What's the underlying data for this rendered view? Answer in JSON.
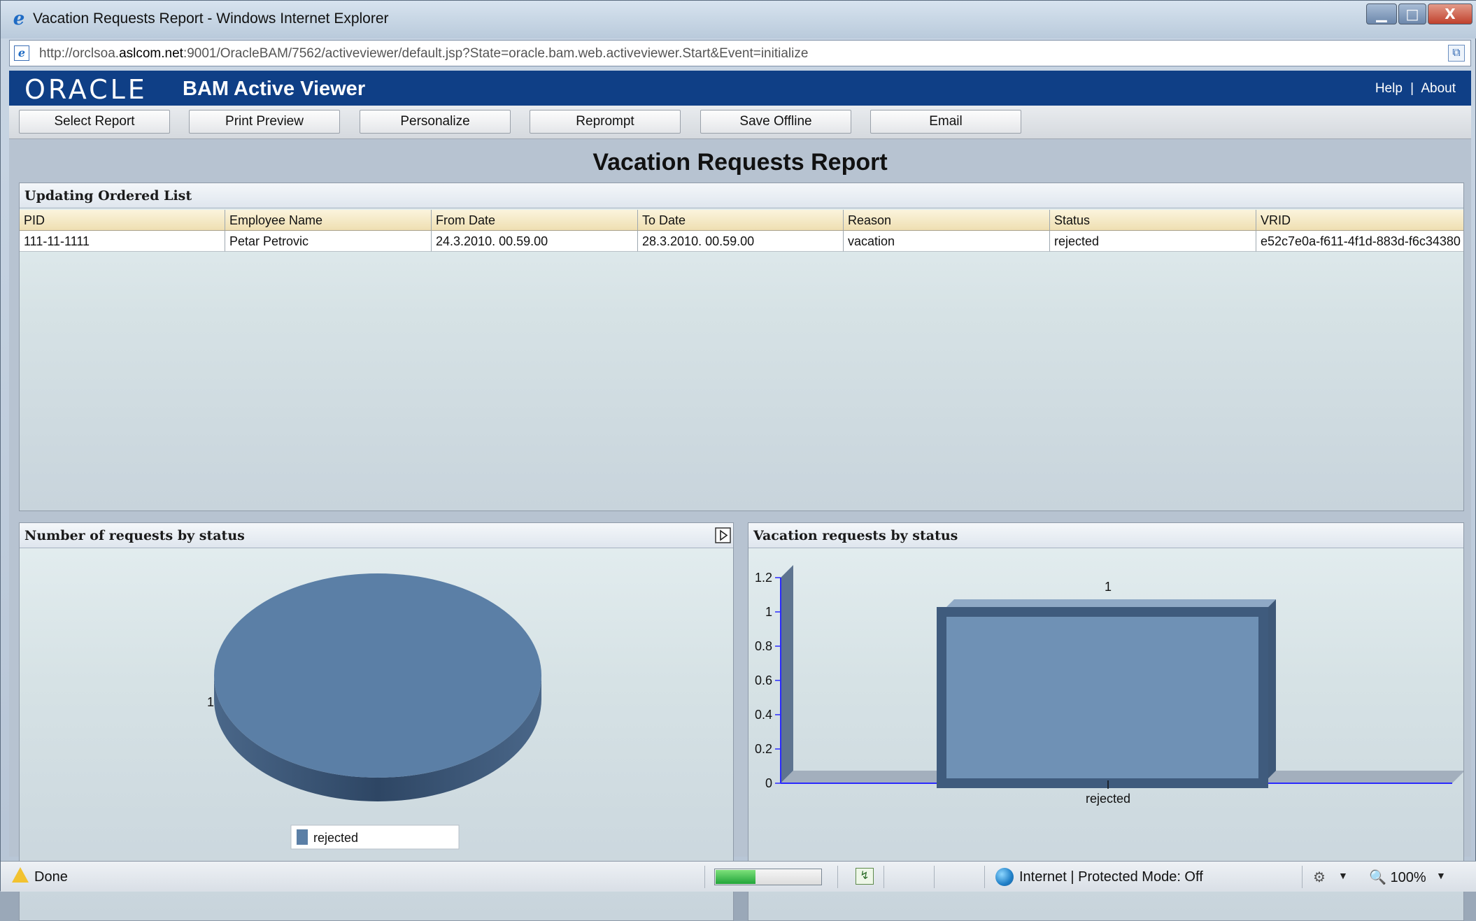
{
  "window": {
    "title": "Vacation Requests Report - Windows Internet Explorer",
    "min_label": "▁",
    "max_label": "□",
    "close_label": "X"
  },
  "address": {
    "url_prefix": "http://orclsoa.",
    "url_host": "aslcom.net",
    "url_rest": ":9001/OracleBAM/7562/activeviewer/default.jsp?State=oracle.bam.web.activeviewer.Start&Event=initialize"
  },
  "header": {
    "logo": "ORACLE",
    "product": "BAM Active Viewer",
    "help": "Help",
    "separator": "|",
    "about": "About"
  },
  "toolbar": {
    "buttons": [
      "Select Report",
      "Print Preview",
      "Personalize",
      "Reprompt",
      "Save Offline",
      "Email"
    ]
  },
  "report": {
    "title": "Vacation Requests Report"
  },
  "list_panel": {
    "title": "Updating Ordered List",
    "columns": [
      "PID",
      "Employee Name",
      "From Date",
      "To Date",
      "Reason",
      "Status",
      "VRID"
    ],
    "rows": [
      [
        "111-11-1111",
        "Petar Petrovic",
        "24.3.2010. 00.59.00",
        "28.3.2010. 00.59.00",
        "vacation",
        "rejected",
        "e52c7e0a-f611-4f1d-883d-f6c34380"
      ]
    ]
  },
  "pie_panel": {
    "title": "Number of requests by status",
    "expand_icon": "expand-icon"
  },
  "bar_panel": {
    "title": "Vacation requests by status"
  },
  "chart_data": [
    {
      "type": "pie",
      "title": "Number of requests by status",
      "categories": [
        "rejected"
      ],
      "values": [
        1
      ],
      "data_labels": [
        "1"
      ],
      "legend": "bottom-center",
      "colors": [
        "#5b7fa6"
      ]
    },
    {
      "type": "bar",
      "title": "Vacation requests by status",
      "categories": [
        "rejected"
      ],
      "values": [
        1
      ],
      "data_labels": [
        "1"
      ],
      "ylim": [
        0,
        1.2
      ],
      "yticks": [
        "0",
        "0.2",
        "0.4",
        "0.6",
        "0.8",
        "1",
        "1.2"
      ],
      "grid": false,
      "colors": [
        "#6f91b5"
      ]
    }
  ],
  "statusbar": {
    "status": "Done",
    "progress": 0.38,
    "zone": "Internet | Protected Mode: Off",
    "zoom": "100%"
  }
}
